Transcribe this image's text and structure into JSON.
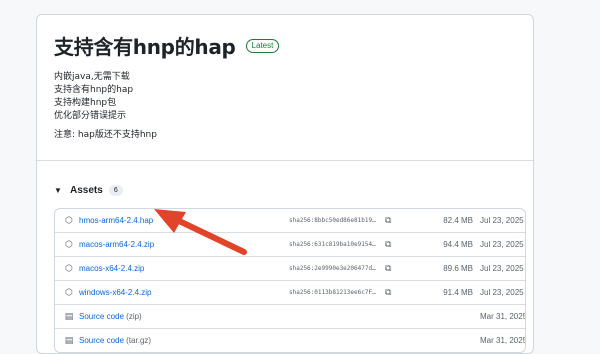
{
  "release": {
    "title": "支持含有hnp的hap",
    "badge": "Latest",
    "notes": [
      "内嵌java,无需下载",
      "支持含有hnp的hap",
      "支持构建hnp包",
      "优化部分错误提示"
    ],
    "note_final": "注意: hap版还不支持hnp"
  },
  "assets": {
    "label": "Assets",
    "count": "6",
    "files": [
      {
        "name": "hmos-arm64-2.4.hap",
        "sha": "sha256:8bbc50ed86e81b19…",
        "size": "82.4 MB",
        "date": "Jul 23, 2025",
        "icon": "package-icon"
      },
      {
        "name": "macos-arm64-2.4.zip",
        "sha": "sha256:631c819ba10e9154…",
        "size": "94.4 MB",
        "date": "Jul 23, 2025",
        "icon": "package-icon"
      },
      {
        "name": "macos-x64-2.4.zip",
        "sha": "sha256:2e9990e3e206477d…",
        "size": "89.6 MB",
        "date": "Jul 23, 2025",
        "icon": "package-icon"
      },
      {
        "name": "windows-x64-2.4.zip",
        "sha": "sha256:0113b81213ee6c7F…",
        "size": "91.4 MB",
        "date": "Jul 23, 2025",
        "icon": "package-icon"
      }
    ],
    "source": [
      {
        "name": "Source code",
        "ext": "(zip)",
        "date": "Mar 31, 2025",
        "icon": "file-zip-icon"
      },
      {
        "name": "Source code",
        "ext": "(tar.gz)",
        "date": "Mar 31, 2025",
        "icon": "file-zip-icon"
      }
    ]
  },
  "colors": {
    "link": "#0969da",
    "latest": "#1a7f37",
    "arrow": "#e0442a"
  }
}
